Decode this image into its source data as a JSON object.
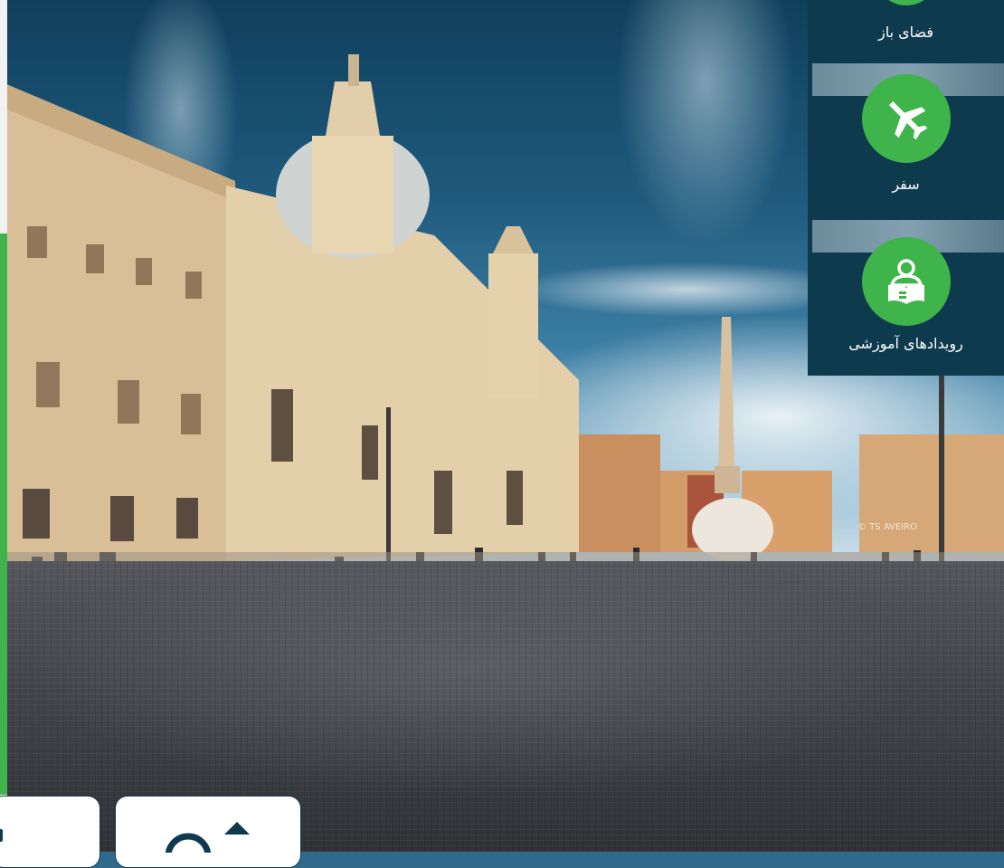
{
  "background": {
    "description_icon": "piazza-navona-photo"
  },
  "watermark": "© TS AVEIRO",
  "categories": [
    {
      "label": "فضای باز",
      "icon": "outdoor-icon",
      "color": "#3fb44b"
    },
    {
      "label": "سفر",
      "icon": "airplane-icon",
      "color": "#3fb44b"
    },
    {
      "label": "رویدادهای آموزشی",
      "icon": "education-reader-icon",
      "color": "#3fb44b"
    }
  ],
  "bottom_cards": [
    {
      "icon": "card-icon-left"
    },
    {
      "icon": "card-icon-house"
    }
  ],
  "colors": {
    "panel": "#0e3a4e",
    "accent": "#3fb44b"
  }
}
